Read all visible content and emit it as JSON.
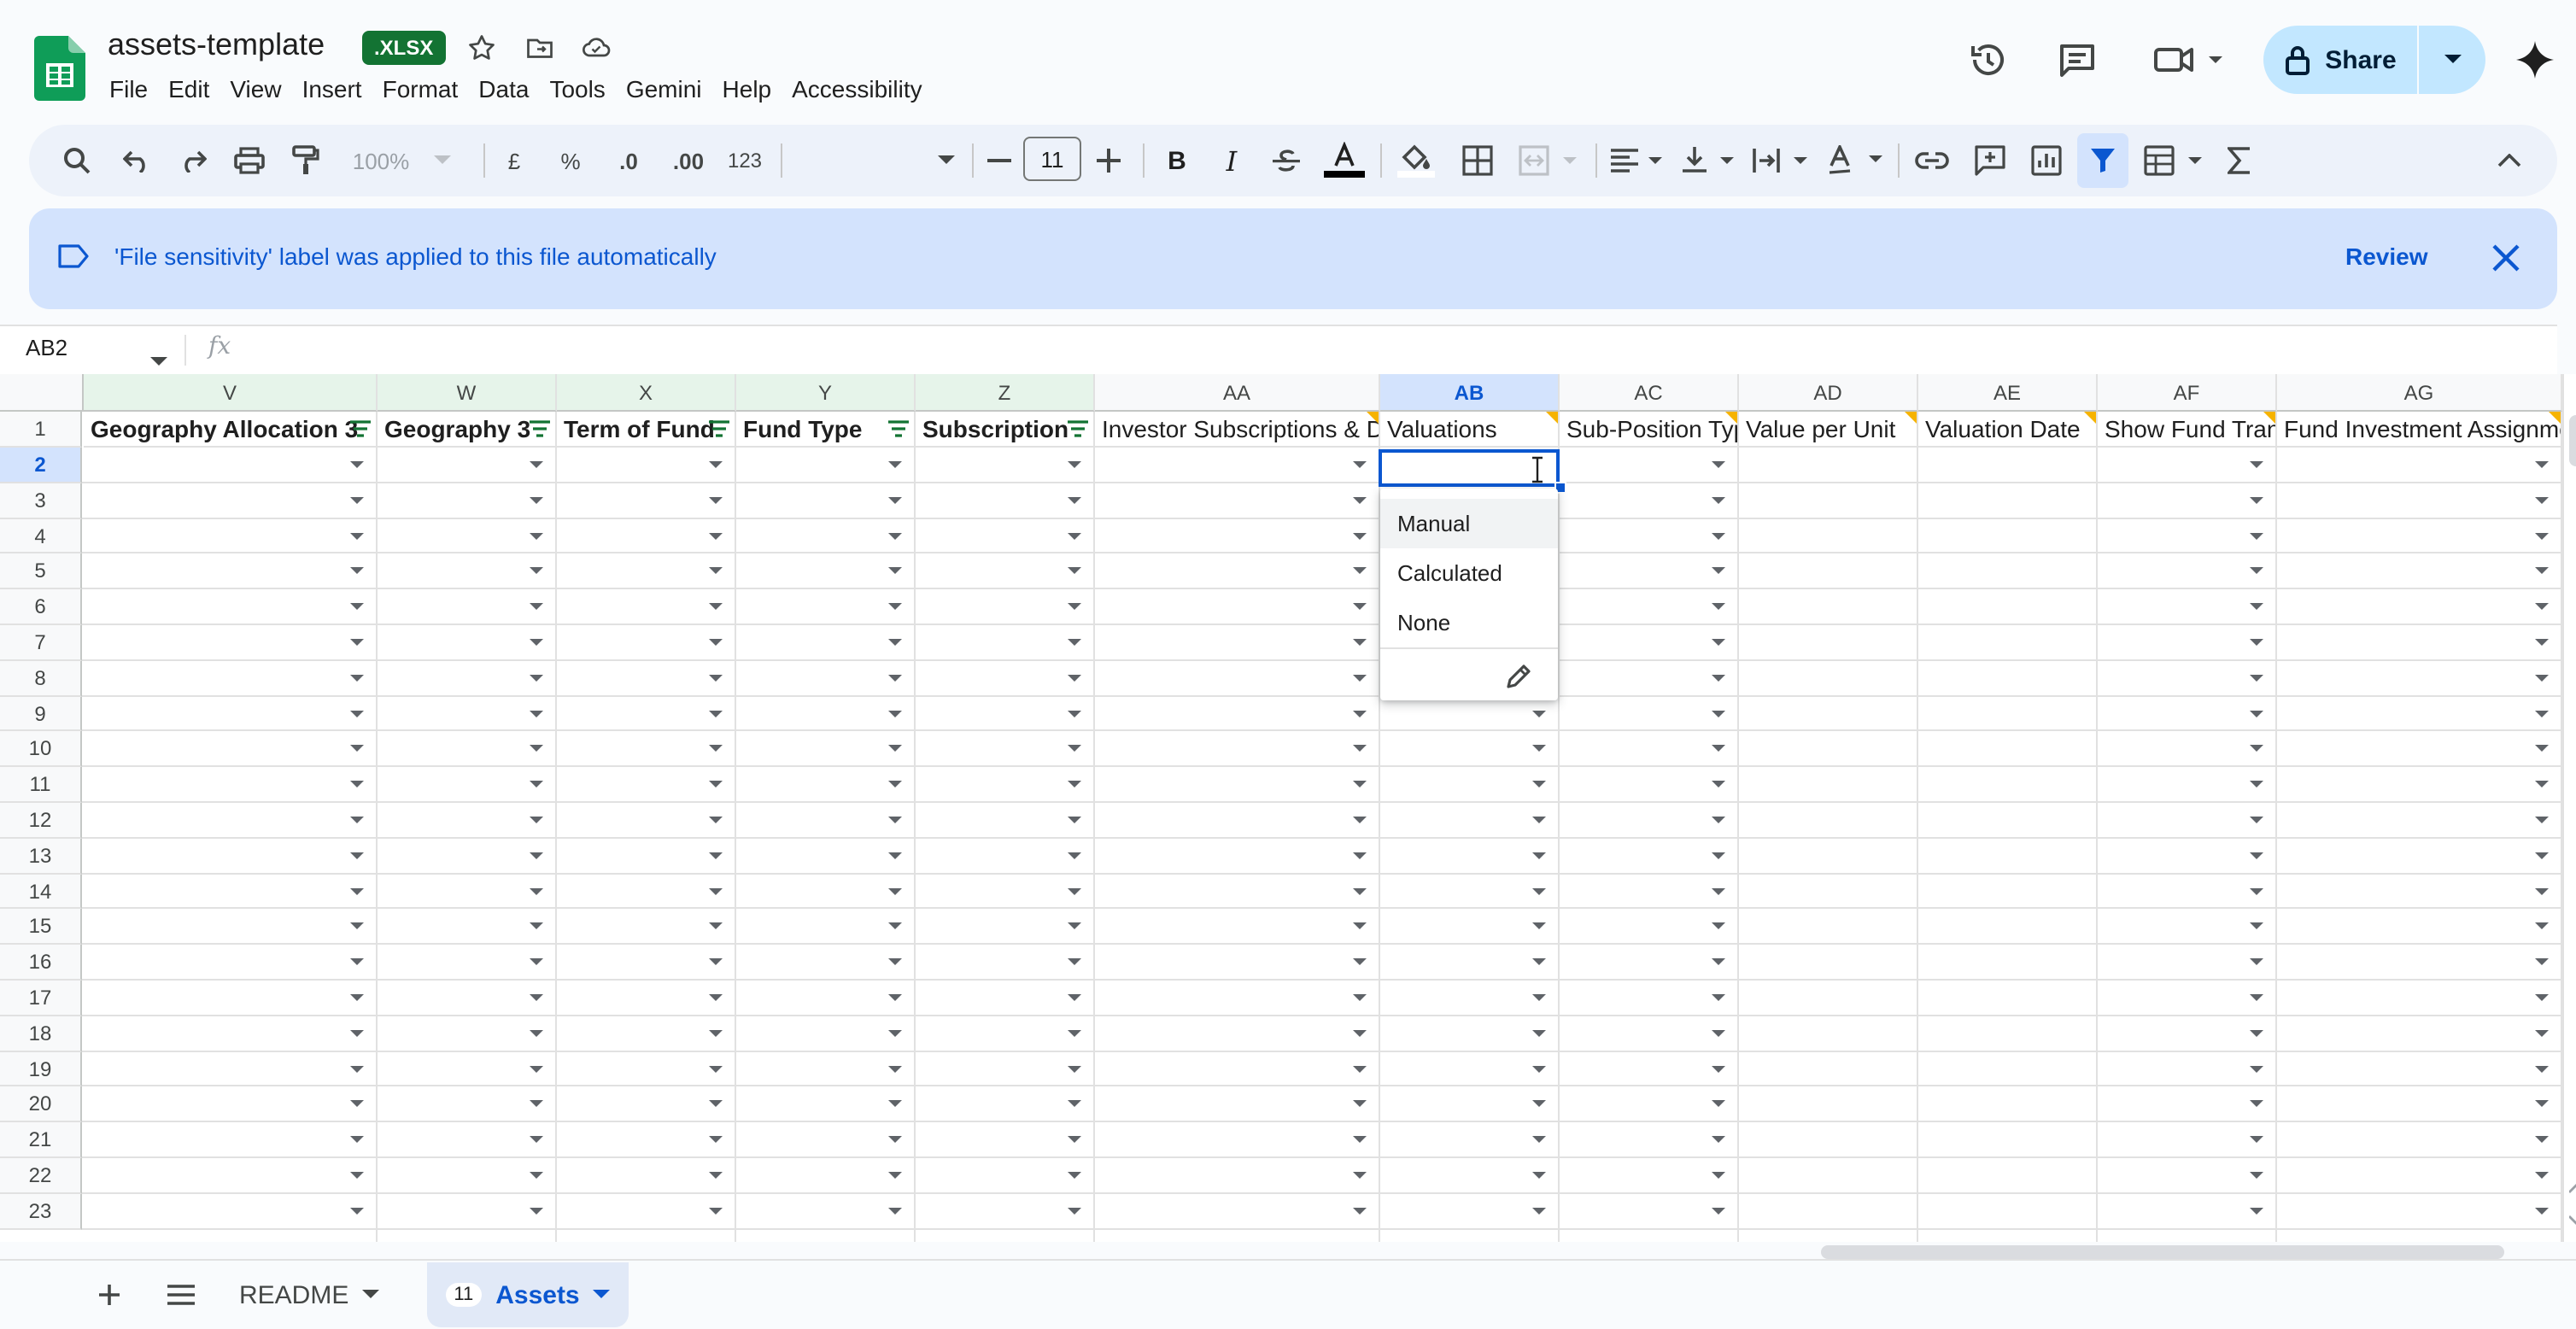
{
  "document": {
    "title": "assets-template",
    "badge": ".XLSX"
  },
  "menu": [
    "File",
    "Edit",
    "View",
    "Insert",
    "Format",
    "Data",
    "Tools",
    "Gemini",
    "Help",
    "Accessibility"
  ],
  "share": {
    "label": "Share"
  },
  "toolbar": {
    "zoom": "100%",
    "currency": "£",
    "percent": "%",
    "decrease_decimal": ".0",
    "increase_decimal": ".00",
    "number_format": "123",
    "font_size": "11"
  },
  "banner": {
    "text": "'File sensitivity' label was applied to this file automatically",
    "review_label": "Review"
  },
  "formula_bar": {
    "name_box": "AB2",
    "fx": "fx"
  },
  "columns": [
    {
      "letter": "V",
      "header": "Geography Allocation 3",
      "filter": true
    },
    {
      "letter": "W",
      "header": "Geography 3",
      "filter": true
    },
    {
      "letter": "X",
      "header": "Term of Fund",
      "filter": true
    },
    {
      "letter": "Y",
      "header": "Fund Type",
      "filter": true
    },
    {
      "letter": "Z",
      "header": "Subscription",
      "filter": true
    },
    {
      "letter": "AA",
      "header": "Investor Subscriptions & D",
      "filter": false
    },
    {
      "letter": "AB",
      "header": "Valuations",
      "filter": false
    },
    {
      "letter": "AC",
      "header": "Sub-Position Typ",
      "filter": false
    },
    {
      "letter": "AD",
      "header": "Value per Unit",
      "filter": false
    },
    {
      "letter": "AE",
      "header": "Valuation Date",
      "filter": false
    },
    {
      "letter": "AF",
      "header": "Show Fund Tran:",
      "filter": false
    },
    {
      "letter": "AG",
      "header": "Fund Investment Assignme",
      "filter": false
    }
  ],
  "rows": [
    "1",
    "2",
    "3",
    "4",
    "5",
    "6",
    "7",
    "8",
    "9",
    "10",
    "11",
    "12",
    "13",
    "14",
    "15",
    "16",
    "17",
    "18",
    "19",
    "20",
    "21",
    "22",
    "23"
  ],
  "selected": {
    "column": "AB",
    "row": "2"
  },
  "dropdown": {
    "options": [
      "Manual",
      "Calculated",
      "None"
    ],
    "highlighted": "Manual"
  },
  "sheets": [
    {
      "name": "README"
    },
    {
      "name": "Assets",
      "count": "11",
      "active": true
    }
  ],
  "colors": {
    "accent": "#0b57d0",
    "share_bg": "#c2e7ff",
    "banner_bg": "#d3e3fd",
    "filter_col_bg": "#e6f4ea",
    "badge_green": "#137333",
    "note_marker": "#f6b300"
  },
  "icons": {
    "title": [
      "star-icon",
      "move-to-folder-icon",
      "cloud-saved-icon"
    ],
    "top": [
      "version-history-icon",
      "comments-icon",
      "meet-icon",
      "gemini-icon"
    ],
    "side": [
      "calendar-icon",
      "keep-icon",
      "tasks-icon",
      "contacts-icon",
      "maps-icon",
      "add-addon-icon"
    ]
  }
}
